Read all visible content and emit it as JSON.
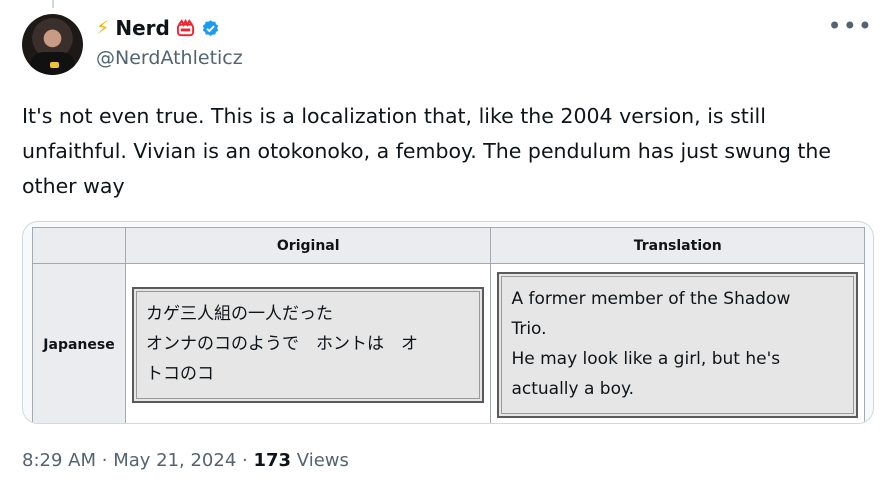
{
  "author": {
    "name": "Nerd",
    "handle": "@NerdAthleticz",
    "emoji_prefix": "⚡",
    "icons": [
      "crown-icon",
      "verified-check-icon"
    ]
  },
  "more_label": "•••",
  "tweet_text": "It's not even true. This is a localization that, like the 2004 version, is still unfaithful. Vivian is an otokonoko, a femboy. The pendulum has just swung the other way",
  "media_table": {
    "headers": [
      "Original",
      "Translation"
    ],
    "row_label": "Japanese",
    "original": [
      "カゲ三人組の一人だった",
      "オンナのコのようで　ホントは　オ",
      "トコのコ"
    ],
    "translation": [
      "A former member of the Shadow",
      "Trio.",
      "He may look like a girl, but he's",
      "actually a boy."
    ]
  },
  "meta": {
    "time": "8:29 AM",
    "date": "May 21, 2024",
    "views_count": "173",
    "views_label": "Views"
  },
  "colors": {
    "text": "#0f1419",
    "secondary": "#536471",
    "verified": "#1d9bf0",
    "crown": "#f4212e"
  }
}
